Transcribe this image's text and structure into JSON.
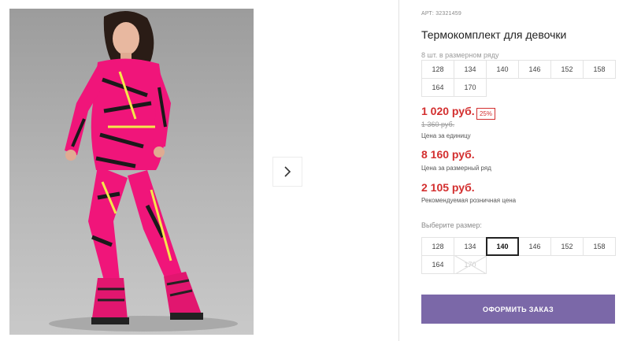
{
  "product": {
    "article": "АРТ: 32321459",
    "title": "Термокомплект для девочки",
    "pack_note": "8 шт. в размерном ряду",
    "pack_sizes": [
      "128",
      "134",
      "140",
      "146",
      "152",
      "158",
      "164",
      "170"
    ],
    "price": "1 020 руб.",
    "discount": "25%",
    "old_price": "1 360 руб.",
    "price_caption": "Цена за единицу",
    "row_price": "8 160 руб.",
    "row_price_caption": "Цена за размерный ряд",
    "retail_price": "2 105 руб.",
    "retail_caption": "Рекомендуемая розничная цена",
    "choose_size_label": "Выберите размер:",
    "sizes": [
      {
        "label": "128",
        "state": "available"
      },
      {
        "label": "134",
        "state": "available"
      },
      {
        "label": "140",
        "state": "selected"
      },
      {
        "label": "146",
        "state": "available"
      },
      {
        "label": "152",
        "state": "available"
      },
      {
        "label": "158",
        "state": "available"
      },
      {
        "label": "164",
        "state": "available"
      },
      {
        "label": "170",
        "state": "disabled"
      }
    ],
    "order_button": "ОФОРМИТЬ ЗАКАЗ"
  },
  "gallery": {
    "next_icon": "chevron-right-icon"
  },
  "colors": {
    "accent_price": "#d32f2f",
    "order_button": "#7b68a8",
    "outfit_pink": "#f0157a"
  }
}
